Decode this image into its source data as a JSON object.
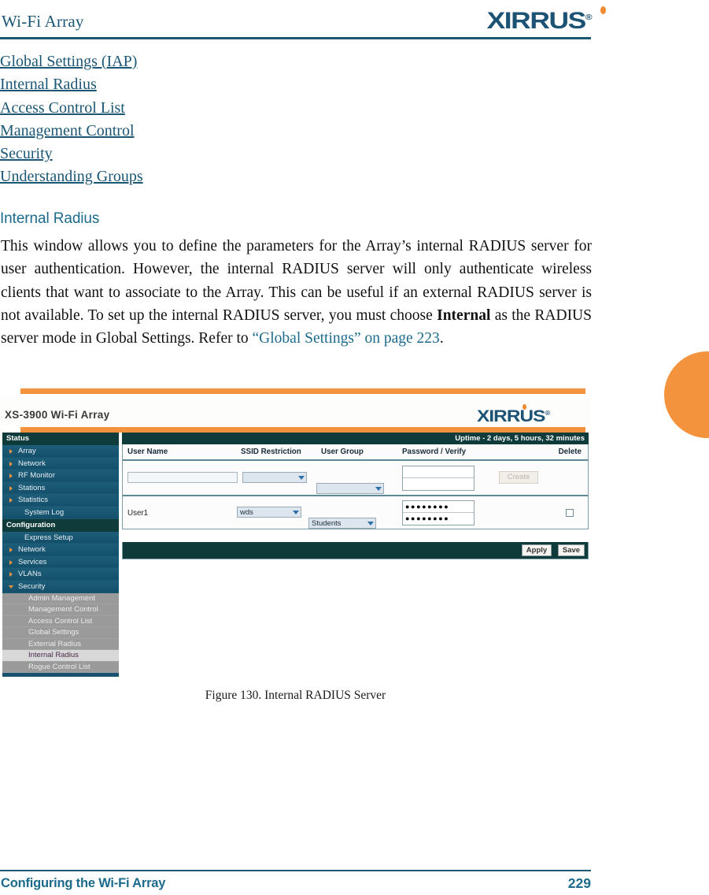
{
  "page_header": {
    "doc_title": "Wi-Fi Array",
    "brand": "XIRRUS",
    "brand_reg": "®"
  },
  "toc": {
    "items": [
      {
        "label": "Global Settings (IAP)"
      },
      {
        "label": "Internal Radius"
      },
      {
        "label": "Access Control List"
      },
      {
        "label": "Management Control"
      },
      {
        "label": "Security"
      },
      {
        "label": "Understanding Groups"
      }
    ]
  },
  "section": {
    "heading": "Internal Radius",
    "paragraph_part1": "This window allows you to define the parameters for the Array’s internal RADIUS server for user authentication. However, the internal RADIUS server will only authenticate wireless clients that want to associate to the Array. This can be useful if an external RADIUS server is not available. To set up the internal RADIUS server, you must choose ",
    "paragraph_bold": "Internal",
    "paragraph_part2": " as the RADIUS server mode in Global Settings. Refer to ",
    "paragraph_xref": "“Global Settings” on page 223",
    "paragraph_part3": "."
  },
  "figure": {
    "caption": "Figure 130. Internal RADIUS Server",
    "app_title": "XS-3900 Wi-Fi Array",
    "brand": "XIRRUS",
    "brand_reg": "®",
    "uptime": "Uptime - 2 days, 5 hours, 32 minutes",
    "sidebar": {
      "groups": [
        {
          "label": "Status",
          "items": [
            {
              "label": "Array",
              "expandable": true
            },
            {
              "label": "Network",
              "expandable": true
            },
            {
              "label": "RF Monitor",
              "expandable": true
            },
            {
              "label": "Stations",
              "expandable": true
            },
            {
              "label": "Statistics",
              "expandable": true
            },
            {
              "label": "System Log",
              "expandable": false
            }
          ]
        },
        {
          "label": "Configuration",
          "items": [
            {
              "label": "Express Setup",
              "expandable": false
            },
            {
              "label": "Network",
              "expandable": true
            },
            {
              "label": "Services",
              "expandable": true
            },
            {
              "label": "VLANs",
              "expandable": true
            },
            {
              "label": "Security",
              "expandable": true,
              "expanded": true
            }
          ],
          "subitems": [
            {
              "label": "Admin Management",
              "selected": false
            },
            {
              "label": "Management Control",
              "selected": false
            },
            {
              "label": "Access Control List",
              "selected": false
            },
            {
              "label": "Global Settings",
              "selected": false
            },
            {
              "label": "External Radius",
              "selected": false
            },
            {
              "label": "Internal Radius",
              "selected": true
            },
            {
              "label": "Rogue Control List",
              "selected": false
            }
          ]
        }
      ]
    },
    "table": {
      "headers": [
        {
          "label": "User Name"
        },
        {
          "label": "SSID Restriction"
        },
        {
          "label": "User Group"
        },
        {
          "label": "Password  /  Verify"
        },
        {
          "label": "Delete"
        }
      ],
      "new_row": {
        "user_name_value": "",
        "user_name_placeholder": "",
        "ssid_value": "",
        "group_value": "",
        "password_value": "",
        "verify_value": "",
        "create_label": "Create"
      },
      "rows": [
        {
          "user_name": "User1",
          "ssid": "wds",
          "group": "Students",
          "password_masked": "●●●●●●●●",
          "verify_masked": "●●●●●●●●",
          "delete_checked": false
        }
      ]
    },
    "actions": {
      "apply_label": "Apply",
      "save_label": "Save"
    }
  },
  "footer": {
    "left": "Configuring the Wi-Fi Array",
    "page_number": "229"
  },
  "colors": {
    "accent_teal": "#1b5674",
    "heading_teal": "#1c6b8c",
    "brand_orange": "#f4933e",
    "app_dark": "#0f3b3a",
    "app_nav_blue": "#17536f",
    "app_sub_gray": "#9a9a9a"
  }
}
